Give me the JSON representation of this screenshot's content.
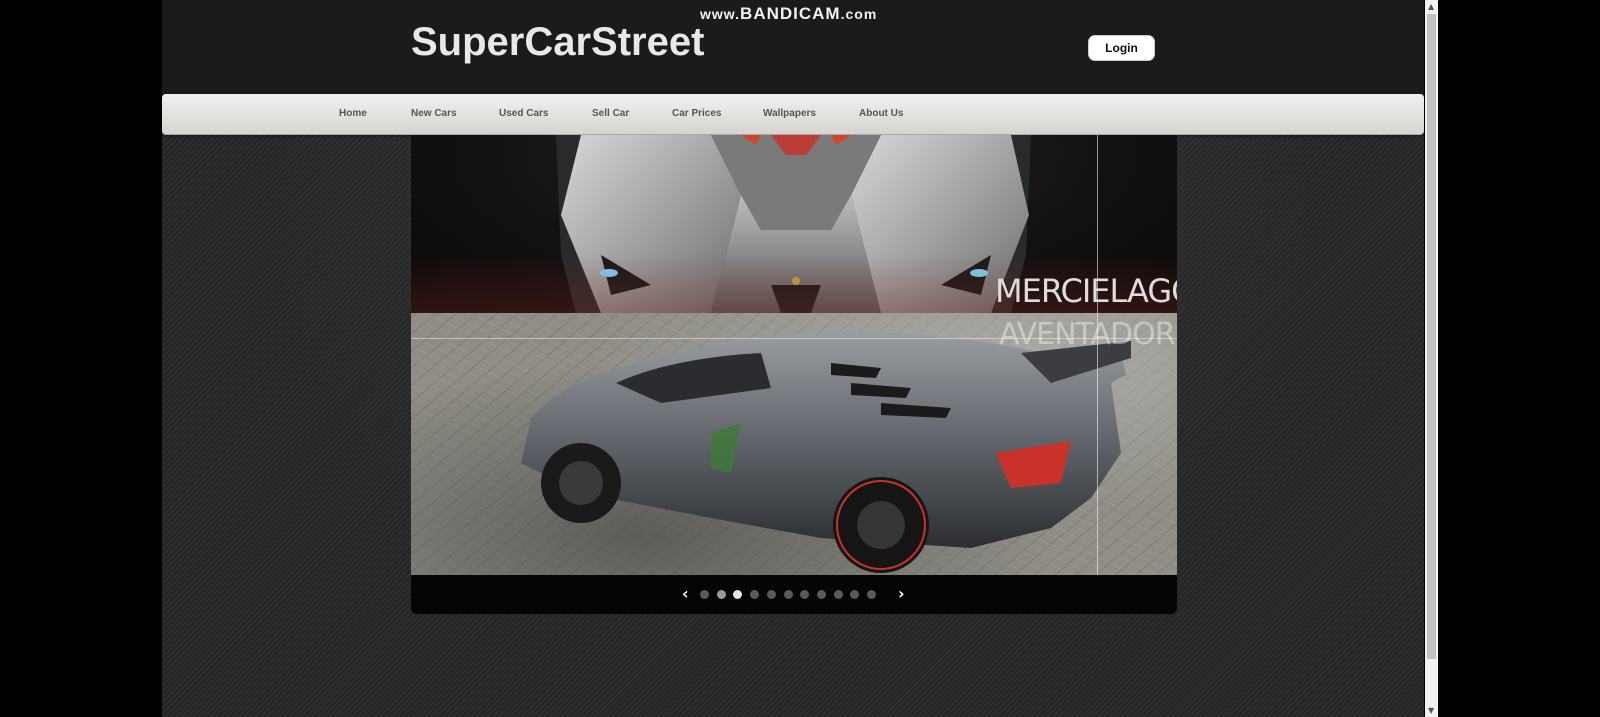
{
  "watermark": {
    "prefix": "www.",
    "main": "BANDICAM",
    "suffix": ".com"
  },
  "header": {
    "logo": "SuperCarStreet",
    "login_label": "Login"
  },
  "nav": {
    "items": [
      {
        "label": "Home"
      },
      {
        "label": "New Cars"
      },
      {
        "label": "Used Cars"
      },
      {
        "label": "Sell Car"
      },
      {
        "label": "Car Prices"
      },
      {
        "label": "Wallpapers"
      },
      {
        "label": "About Us"
      }
    ]
  },
  "slider": {
    "caption_1": "MERCIELAGO",
    "caption_2": "AVENTADOR",
    "prev_icon": "chevron-left-icon",
    "next_icon": "chevron-right-icon",
    "prev_glyph": "‹",
    "next_glyph": "›",
    "dot_count": 11,
    "active_dot_index": 2,
    "highlight_dot_index": 1
  },
  "colors": {
    "header_bg": "#1b1b1b",
    "nav_text": "#555555",
    "brake_accent": "#c8322a"
  }
}
